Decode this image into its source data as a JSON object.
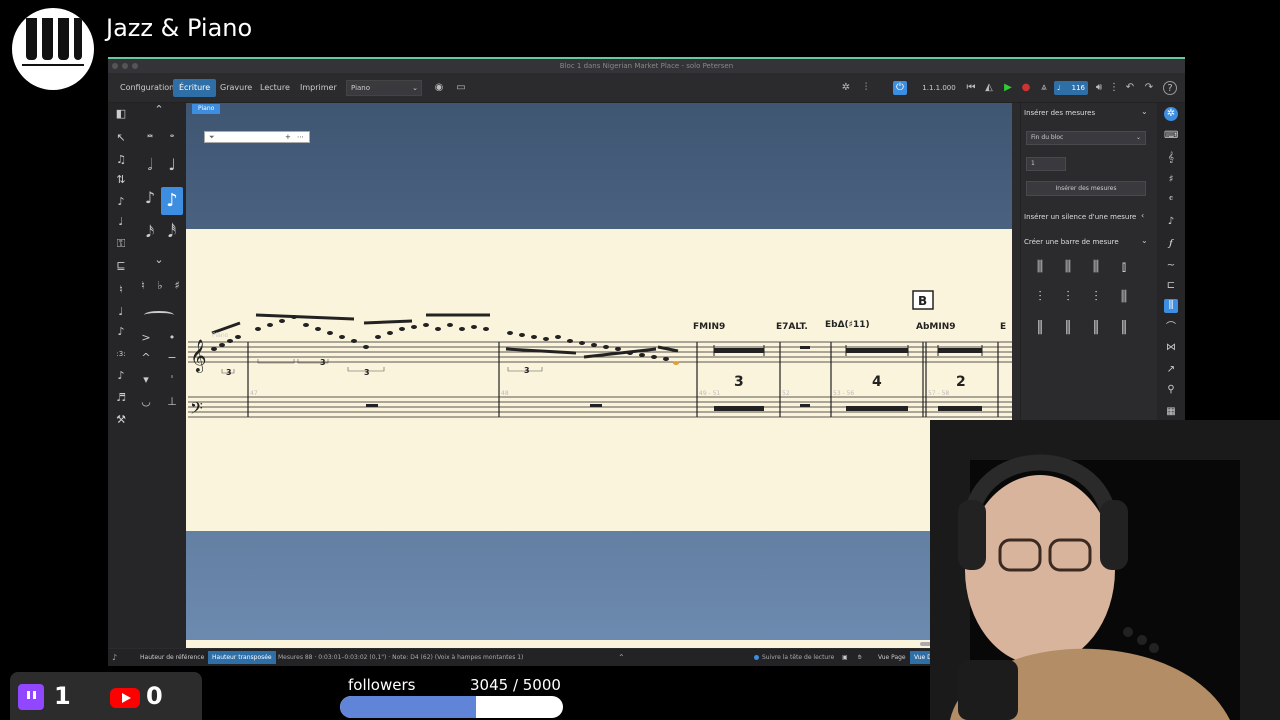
{
  "stream": {
    "title": "Jazz & Piano"
  },
  "app": {
    "window_title": "Bloc 1 dans Nigerian Market Place - solo Petersen",
    "modes": [
      "Configuration",
      "Écriture",
      "Gravure",
      "Lecture",
      "Imprimer"
    ],
    "active_mode": "Écriture",
    "instrument_select": "Piano",
    "transport": {
      "position": "1.1.1.000",
      "tempo": "116"
    },
    "part_tab": "Piano",
    "accent_color": "#3d8de0"
  },
  "score": {
    "rehearsal_mark": "B",
    "chords": [
      "FMIN9",
      "E7ALT.",
      "EbΔ(♯11)",
      "AbMIN9",
      "E"
    ],
    "multirests": [
      "3",
      "4",
      "2"
    ],
    "bar_numbers": [
      "47",
      "48",
      "49 - 51",
      "52",
      "53 - 56",
      "57 - 58"
    ],
    "tuplet": "3"
  },
  "panel": {
    "section1": "Insérer des mesures",
    "position_select": "Fin du bloc",
    "count_value": "1",
    "insert_button": "Insérer des mesures",
    "section2": "Insérer un silence d'une mesure",
    "section3": "Créer une barre de mesure"
  },
  "statusbar": {
    "ref_pitch": "Hauteur de référence",
    "transposed_pitch": "Hauteur transposée",
    "info": "Mesures 88 · 0:03:01–0:03:02 (0,1\") · Note: D4 (62) (Voix à hampes montantes 1)",
    "follow": "Suivre la tête de lecture",
    "page_view": "Vue Page",
    "galley_view": "Vue Défilée"
  },
  "overlay": {
    "twitch_count": "1",
    "youtube_count": "0",
    "followers_label": "followers",
    "followers_value": "3045 / 5000",
    "followers_fraction": 0.609,
    "twitch_color": "#9146ff",
    "youtube_color": "#ff0000"
  }
}
